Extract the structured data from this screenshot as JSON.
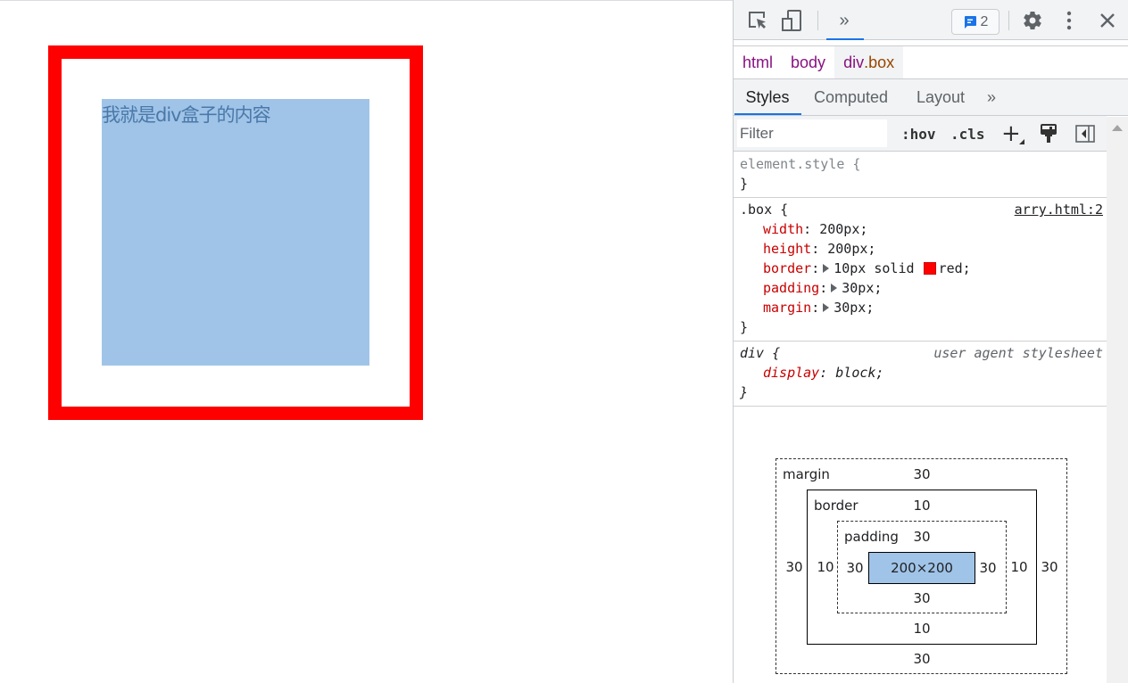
{
  "page": {
    "box_text": "我就是div盒子的内容",
    "colors": {
      "border": "#ff0000",
      "content_highlight": "#a0c4e8"
    }
  },
  "devtools": {
    "toolbar": {
      "inspect_icon": "inspect-element-icon",
      "device_icon": "device-toolbar-icon",
      "more_tabs_label": "»",
      "issues_count": "2",
      "settings_icon": "gear-icon",
      "menu_icon": "kebab-menu-icon",
      "close_icon": "close-icon"
    },
    "breadcrumb": [
      {
        "tag": "html",
        "cls": ""
      },
      {
        "tag": "body",
        "cls": ""
      },
      {
        "tag": "div",
        "cls": ".box"
      }
    ],
    "tabs": {
      "styles": "Styles",
      "computed": "Computed",
      "layout": "Layout",
      "more": "»"
    },
    "filterbar": {
      "placeholder": "Filter",
      "hov": ":hov",
      "cls": ".cls",
      "plus": "+"
    },
    "rules": {
      "element_style": {
        "selector": "element.style {",
        "close": "}"
      },
      "box": {
        "selector": ".box {",
        "source": "arry.html:2",
        "props": [
          {
            "name": "width",
            "value": "200px;"
          },
          {
            "name": "height",
            "value": "200px;"
          },
          {
            "name": "border",
            "value": "10px solid",
            "color_value": "red;",
            "swatch": "#ff0000"
          },
          {
            "name": "padding",
            "value": "30px;"
          },
          {
            "name": "margin",
            "value": "30px;"
          }
        ],
        "close": "}"
      },
      "div_ua": {
        "selector": "div {",
        "source": "user agent stylesheet",
        "props": [
          {
            "name": "display",
            "value": "block;"
          }
        ],
        "close": "}"
      }
    },
    "box_model": {
      "margin": {
        "label": "margin",
        "top": "30",
        "right": "30",
        "bottom": "30",
        "left": "30"
      },
      "border": {
        "label": "border",
        "top": "10",
        "right": "10",
        "bottom": "10",
        "left": "10"
      },
      "padding": {
        "label": "padding",
        "top": "30",
        "right": "30",
        "bottom": "30",
        "left": "30"
      },
      "content": "200×200"
    }
  }
}
